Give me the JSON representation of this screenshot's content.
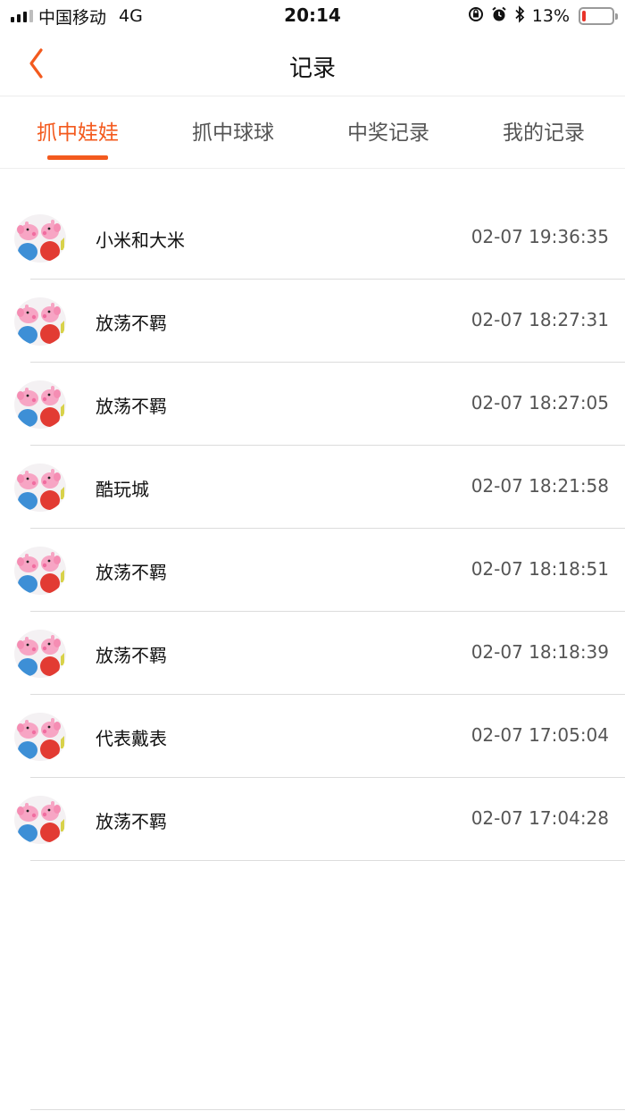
{
  "status_bar": {
    "carrier": "中国移动",
    "network": "4G",
    "time": "20:14",
    "battery_percent": "13%",
    "battery_level": 0.13,
    "battery_color": "#e8342a",
    "icons": [
      "orientation-lock-icon",
      "alarm-icon",
      "bluetooth-icon"
    ]
  },
  "nav": {
    "title": "记录",
    "back_icon": "chevron-left-icon",
    "accent": "#f35a1e"
  },
  "tabs": [
    {
      "label": "抓中娃娃",
      "active": true
    },
    {
      "label": "抓中球球",
      "active": false
    },
    {
      "label": "中奖记录",
      "active": false
    },
    {
      "label": "我的记录",
      "active": false
    }
  ],
  "records": [
    {
      "name": "小米和大米",
      "time": "02-07 19:36:35",
      "avatar": "peppa-pig-plush-icon"
    },
    {
      "name": "放荡不羁",
      "time": "02-07 18:27:31",
      "avatar": "peppa-pig-plush-icon"
    },
    {
      "name": "放荡不羁",
      "time": "02-07 18:27:05",
      "avatar": "peppa-pig-plush-icon"
    },
    {
      "name": "酷玩城",
      "time": "02-07 18:21:58",
      "avatar": "peppa-pig-plush-icon"
    },
    {
      "name": "放荡不羁",
      "time": "02-07 18:18:51",
      "avatar": "peppa-pig-plush-icon"
    },
    {
      "name": "放荡不羁",
      "time": "02-07 18:18:39",
      "avatar": "peppa-pig-plush-icon"
    },
    {
      "name": "代表戴表",
      "time": "02-07 17:05:04",
      "avatar": "peppa-pig-plush-icon"
    },
    {
      "name": "放荡不羁",
      "time": "02-07 17:04:28",
      "avatar": "peppa-pig-plush-icon"
    }
  ]
}
